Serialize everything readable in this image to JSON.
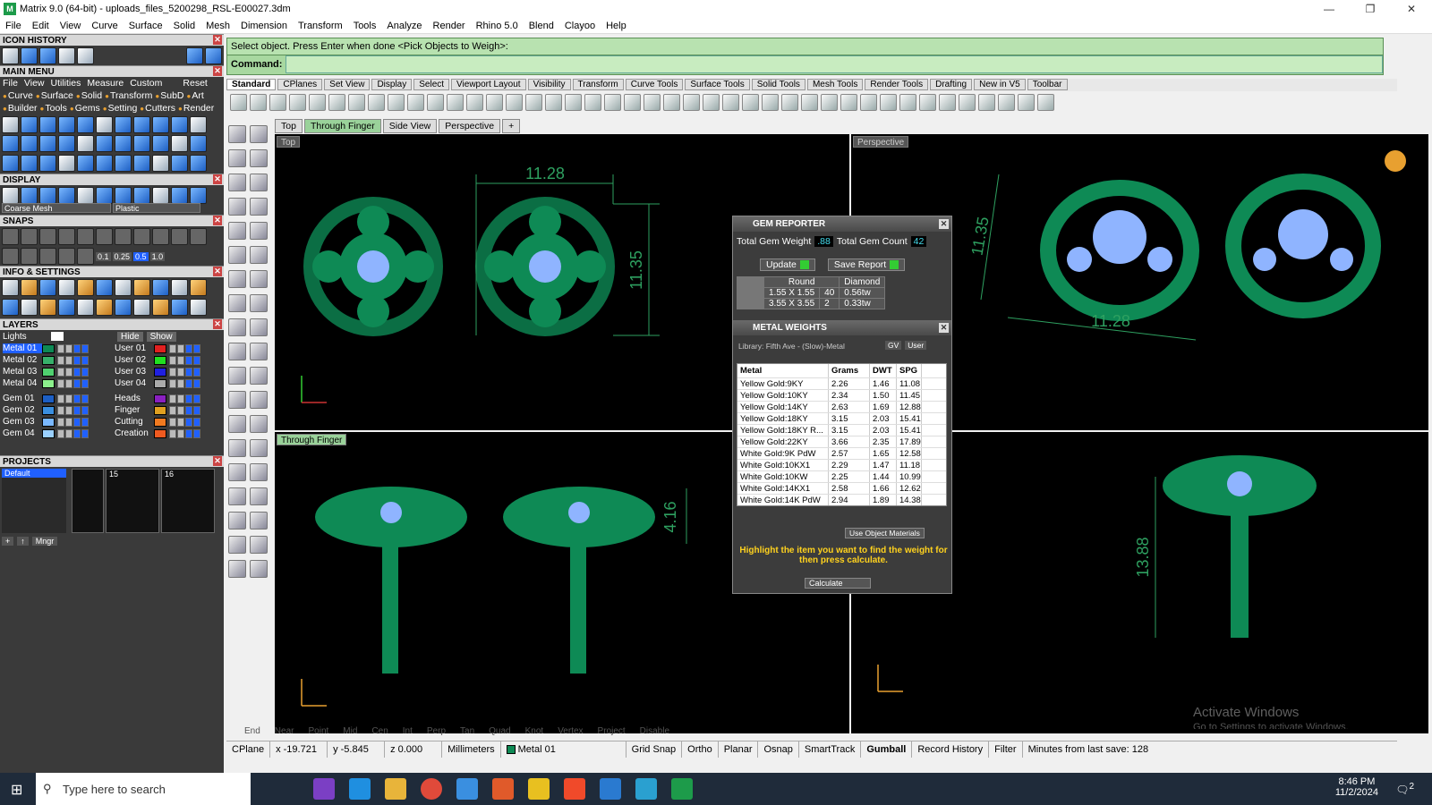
{
  "window": {
    "title": "Matrix 9.0 (64-bit) - uploads_files_5200298_RSL-E00027.3dm"
  },
  "menu": [
    "File",
    "Edit",
    "View",
    "Curve",
    "Surface",
    "Solid",
    "Mesh",
    "Dimension",
    "Transform",
    "Tools",
    "Analyze",
    "Render",
    "Rhino 5.0",
    "Blend",
    "Clayoo",
    "Help"
  ],
  "left": {
    "icon_history": "ICON HISTORY",
    "main_menu": "MAIN MENU",
    "mm_row1": [
      "File",
      "View",
      "Utilities",
      "Measure",
      "Custom",
      "Reset"
    ],
    "mm_row2": [
      "Curve",
      "Surface",
      "Solid",
      "Transform",
      "SubD",
      "Art"
    ],
    "mm_row3": [
      "Builder",
      "Tools",
      "Gems",
      "Setting",
      "Cutters",
      "Render"
    ],
    "display": "DISPLAY",
    "display_opts": [
      "Coarse Mesh",
      "Plastic"
    ],
    "snaps": "SNAPS",
    "snap_vals": [
      "0.1",
      "0.25",
      "0.5",
      "1.0"
    ],
    "info": "INFO & SETTINGS",
    "layers": "LAYERS",
    "lights": "Lights",
    "hide": "Hide",
    "show": "Show",
    "layer_left": [
      "Metal 01",
      "Metal 02",
      "Metal 03",
      "Metal 04",
      "Gem 01",
      "Gem 02",
      "Gem 03",
      "Gem 04"
    ],
    "layer_right": [
      "User 01",
      "User 02",
      "User 03",
      "User 04",
      "Heads",
      "Finger",
      "Cutting",
      "Creation"
    ],
    "projects": "PROJECTS",
    "project_default": "Default",
    "proj_nums": [
      "15",
      "16"
    ],
    "mngr": "Mngr"
  },
  "command": {
    "prompt": "Select object. Press Enter when done <Pick Objects to Weigh>:",
    "label": "Command:"
  },
  "tabs": [
    "Standard",
    "CPlanes",
    "Set View",
    "Display",
    "Select",
    "Viewport Layout",
    "Visibility",
    "Transform",
    "Curve Tools",
    "Surface Tools",
    "Solid Tools",
    "Mesh Tools",
    "Render Tools",
    "Drafting",
    "New in V5",
    "Toolbar"
  ],
  "view_tabs": [
    "Top",
    "Through Finger",
    "Side View",
    "Perspective"
  ],
  "viewports": {
    "tl": {
      "label": "Top",
      "dim_w": "11.28",
      "dim_h": "11.35"
    },
    "tr": {
      "label": "Perspective",
      "dim_w": "11.28",
      "dim_h": "11.35"
    },
    "bl": {
      "label": "Through Finger",
      "dim_h": "4.16"
    },
    "br": {
      "dim_h": "13.88"
    }
  },
  "gem_reporter": {
    "title": "GEM REPORTER",
    "total_weight_label": "Total Gem Weight",
    "total_weight": ".88",
    "total_count_label": "Total Gem Count",
    "total_count": "42",
    "update": "Update",
    "save_report": "Save Report",
    "headers": [
      "Round",
      "Diamond"
    ],
    "rows": [
      [
        "1.55 X 1.55",
        "40",
        "0.56tw"
      ],
      [
        "3.55 X 3.55",
        "2",
        "0.33tw"
      ]
    ]
  },
  "metal_weights": {
    "title": "METAL WEIGHTS",
    "library": "Library: Fifth Ave - (Slow)-Metal",
    "gv": "GV",
    "user": "User",
    "headers": [
      "Metal",
      "Grams",
      "DWT",
      "SPG"
    ],
    "rows": [
      [
        "Yellow Gold:9KY",
        "2.26",
        "1.46",
        "11.08"
      ],
      [
        "Yellow Gold:10KY",
        "2.34",
        "1.50",
        "11.45"
      ],
      [
        "Yellow Gold:14KY",
        "2.63",
        "1.69",
        "12.88"
      ],
      [
        "Yellow Gold:18KY",
        "3.15",
        "2.03",
        "15.41"
      ],
      [
        "Yellow Gold:18KY R...",
        "3.15",
        "2.03",
        "15.41"
      ],
      [
        "Yellow Gold:22KY",
        "3.66",
        "2.35",
        "17.89"
      ],
      [
        "White Gold:9K PdW",
        "2.57",
        "1.65",
        "12.58"
      ],
      [
        "White Gold:10KX1",
        "2.29",
        "1.47",
        "11.18"
      ],
      [
        "White Gold:10KW",
        "2.25",
        "1.44",
        "10.99"
      ],
      [
        "White Gold:14KX1",
        "2.58",
        "1.66",
        "12.62"
      ],
      [
        "White Gold:14K PdW",
        "2.94",
        "1.89",
        "14.38"
      ]
    ],
    "use_obj": "Use Object Materials",
    "hint": "Highlight the item you want to find the weight for then press calculate.",
    "calculate": "Calculate"
  },
  "snaps_bar": [
    "End",
    "Near",
    "Point",
    "Mid",
    "Cen",
    "Int",
    "Perp",
    "Tan",
    "Quad",
    "Knot",
    "Vertex",
    "Project",
    "Disable"
  ],
  "status": {
    "cplane": "CPlane",
    "x": "x -19.721",
    "y": "y -5.845",
    "z": "z 0.000",
    "units": "Millimeters",
    "layer": "Metal 01",
    "grid": "Grid Snap",
    "ortho": "Ortho",
    "planar": "Planar",
    "osnap": "Osnap",
    "smarttrack": "SmartTrack",
    "gumball": "Gumball",
    "record": "Record History",
    "filter": "Filter",
    "minutes": "Minutes from last save: 128"
  },
  "watermark": {
    "line1": "Activate Windows",
    "line2": "Go to Settings to activate Windows."
  },
  "taskbar": {
    "search": "Type here to search",
    "time": "8:46 PM",
    "date": "11/2/2024",
    "notif": "2"
  },
  "colors": {
    "ring": "#0e8a55",
    "gem": "#8fb4ff",
    "dim": "#2ea060"
  }
}
